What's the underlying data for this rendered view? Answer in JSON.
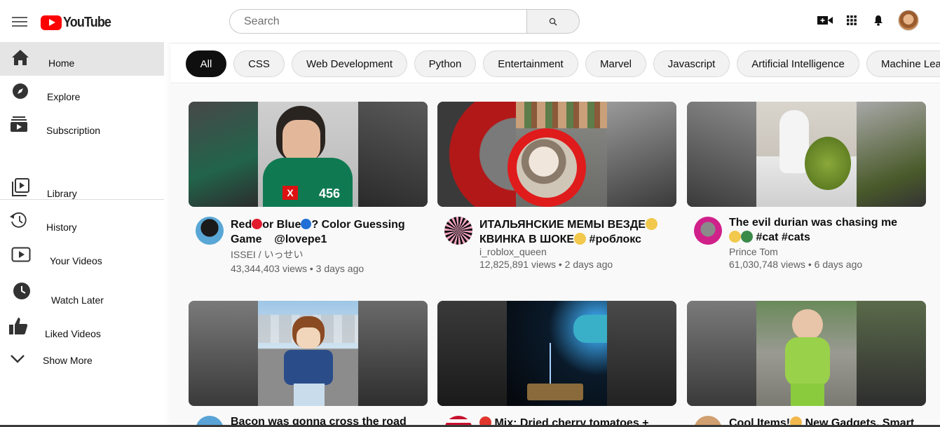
{
  "header": {
    "logo_text": "YouTube",
    "search_placeholder": "Search"
  },
  "sidebar": {
    "items": [
      {
        "label": "Home",
        "icon": "home-icon",
        "active": true
      },
      {
        "label": "Explore",
        "icon": "compass-icon"
      },
      {
        "label": "Subscription",
        "icon": "subscriptions-icon"
      },
      {
        "label": "Library",
        "icon": "library-icon"
      },
      {
        "label": "History",
        "icon": "history-icon"
      },
      {
        "label": "Your Videos",
        "icon": "play-video-icon"
      },
      {
        "label": "Watch Later",
        "icon": "clock-icon"
      },
      {
        "label": "Liked Videos",
        "icon": "thumbs-up-icon"
      },
      {
        "label": "Show More",
        "icon": "chevron-down-icon"
      }
    ]
  },
  "chips": [
    "All",
    "CSS",
    "Web Development",
    "Python",
    "Entertainment",
    "Marvel",
    "Javascript",
    "Artificial Intelligence",
    "Machine Lea"
  ],
  "videos": [
    {
      "title_parts": [
        "Red",
        "or Blue",
        "? Color Guessing"
      ],
      "title_line2": "Game    @lovepe1",
      "channel": "ISSEI / いっせい",
      "views": "43,344,403 views",
      "age": "3 days ago"
    },
    {
      "title_line1": "ИТАЛЬЯНСКИЕ МЕМЫ ВЕЗДЕ",
      "title_line2": "КВИНКА В ШОКЕ",
      "title_tag": " #роблокс",
      "channel": "i_roblox_queen",
      "views": "12,825,891 views",
      "age": "2 days ago"
    },
    {
      "title_line1": "The evil durian was chasing me",
      "title_line2": " #cat #cats",
      "channel": "Prince Tom",
      "views": "61,030,748 views",
      "age": "6 days ago"
    },
    {
      "title_line1": "Bacon was gonna cross the road"
    },
    {
      "title_line1": " Mix: Dried cherry tomatoes +"
    },
    {
      "title_line1": "Cool Items!",
      "title_line1b": " New Gadgets, Smart"
    }
  ],
  "colors": {
    "accent": "#ff0000",
    "chip_active": "#0f0f0f",
    "chip_bg": "#f2f2f2",
    "meta_text": "#606060"
  }
}
